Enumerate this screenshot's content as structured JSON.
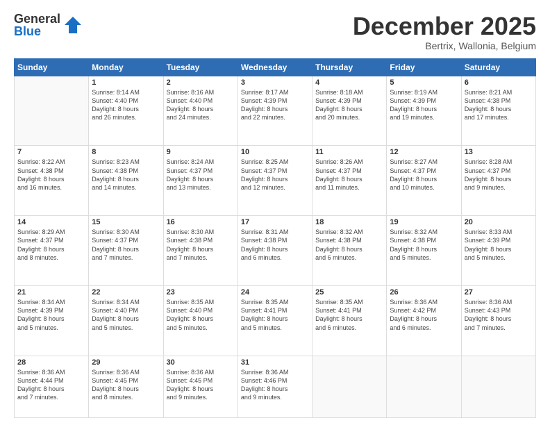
{
  "logo": {
    "general": "General",
    "blue": "Blue"
  },
  "title": "December 2025",
  "subtitle": "Bertrix, Wallonia, Belgium",
  "header_days": [
    "Sunday",
    "Monday",
    "Tuesday",
    "Wednesday",
    "Thursday",
    "Friday",
    "Saturday"
  ],
  "weeks": [
    [
      {
        "day": "",
        "info": ""
      },
      {
        "day": "1",
        "info": "Sunrise: 8:14 AM\nSunset: 4:40 PM\nDaylight: 8 hours\nand 26 minutes."
      },
      {
        "day": "2",
        "info": "Sunrise: 8:16 AM\nSunset: 4:40 PM\nDaylight: 8 hours\nand 24 minutes."
      },
      {
        "day": "3",
        "info": "Sunrise: 8:17 AM\nSunset: 4:39 PM\nDaylight: 8 hours\nand 22 minutes."
      },
      {
        "day": "4",
        "info": "Sunrise: 8:18 AM\nSunset: 4:39 PM\nDaylight: 8 hours\nand 20 minutes."
      },
      {
        "day": "5",
        "info": "Sunrise: 8:19 AM\nSunset: 4:39 PM\nDaylight: 8 hours\nand 19 minutes."
      },
      {
        "day": "6",
        "info": "Sunrise: 8:21 AM\nSunset: 4:38 PM\nDaylight: 8 hours\nand 17 minutes."
      }
    ],
    [
      {
        "day": "7",
        "info": "Sunrise: 8:22 AM\nSunset: 4:38 PM\nDaylight: 8 hours\nand 16 minutes."
      },
      {
        "day": "8",
        "info": "Sunrise: 8:23 AM\nSunset: 4:38 PM\nDaylight: 8 hours\nand 14 minutes."
      },
      {
        "day": "9",
        "info": "Sunrise: 8:24 AM\nSunset: 4:37 PM\nDaylight: 8 hours\nand 13 minutes."
      },
      {
        "day": "10",
        "info": "Sunrise: 8:25 AM\nSunset: 4:37 PM\nDaylight: 8 hours\nand 12 minutes."
      },
      {
        "day": "11",
        "info": "Sunrise: 8:26 AM\nSunset: 4:37 PM\nDaylight: 8 hours\nand 11 minutes."
      },
      {
        "day": "12",
        "info": "Sunrise: 8:27 AM\nSunset: 4:37 PM\nDaylight: 8 hours\nand 10 minutes."
      },
      {
        "day": "13",
        "info": "Sunrise: 8:28 AM\nSunset: 4:37 PM\nDaylight: 8 hours\nand 9 minutes."
      }
    ],
    [
      {
        "day": "14",
        "info": "Sunrise: 8:29 AM\nSunset: 4:37 PM\nDaylight: 8 hours\nand 8 minutes."
      },
      {
        "day": "15",
        "info": "Sunrise: 8:30 AM\nSunset: 4:37 PM\nDaylight: 8 hours\nand 7 minutes."
      },
      {
        "day": "16",
        "info": "Sunrise: 8:30 AM\nSunset: 4:38 PM\nDaylight: 8 hours\nand 7 minutes."
      },
      {
        "day": "17",
        "info": "Sunrise: 8:31 AM\nSunset: 4:38 PM\nDaylight: 8 hours\nand 6 minutes."
      },
      {
        "day": "18",
        "info": "Sunrise: 8:32 AM\nSunset: 4:38 PM\nDaylight: 8 hours\nand 6 minutes."
      },
      {
        "day": "19",
        "info": "Sunrise: 8:32 AM\nSunset: 4:38 PM\nDaylight: 8 hours\nand 5 minutes."
      },
      {
        "day": "20",
        "info": "Sunrise: 8:33 AM\nSunset: 4:39 PM\nDaylight: 8 hours\nand 5 minutes."
      }
    ],
    [
      {
        "day": "21",
        "info": "Sunrise: 8:34 AM\nSunset: 4:39 PM\nDaylight: 8 hours\nand 5 minutes."
      },
      {
        "day": "22",
        "info": "Sunrise: 8:34 AM\nSunset: 4:40 PM\nDaylight: 8 hours\nand 5 minutes."
      },
      {
        "day": "23",
        "info": "Sunrise: 8:35 AM\nSunset: 4:40 PM\nDaylight: 8 hours\nand 5 minutes."
      },
      {
        "day": "24",
        "info": "Sunrise: 8:35 AM\nSunset: 4:41 PM\nDaylight: 8 hours\nand 5 minutes."
      },
      {
        "day": "25",
        "info": "Sunrise: 8:35 AM\nSunset: 4:41 PM\nDaylight: 8 hours\nand 6 minutes."
      },
      {
        "day": "26",
        "info": "Sunrise: 8:36 AM\nSunset: 4:42 PM\nDaylight: 8 hours\nand 6 minutes."
      },
      {
        "day": "27",
        "info": "Sunrise: 8:36 AM\nSunset: 4:43 PM\nDaylight: 8 hours\nand 7 minutes."
      }
    ],
    [
      {
        "day": "28",
        "info": "Sunrise: 8:36 AM\nSunset: 4:44 PM\nDaylight: 8 hours\nand 7 minutes."
      },
      {
        "day": "29",
        "info": "Sunrise: 8:36 AM\nSunset: 4:45 PM\nDaylight: 8 hours\nand 8 minutes."
      },
      {
        "day": "30",
        "info": "Sunrise: 8:36 AM\nSunset: 4:45 PM\nDaylight: 8 hours\nand 9 minutes."
      },
      {
        "day": "31",
        "info": "Sunrise: 8:36 AM\nSunset: 4:46 PM\nDaylight: 8 hours\nand 9 minutes."
      },
      {
        "day": "",
        "info": ""
      },
      {
        "day": "",
        "info": ""
      },
      {
        "day": "",
        "info": ""
      }
    ]
  ]
}
